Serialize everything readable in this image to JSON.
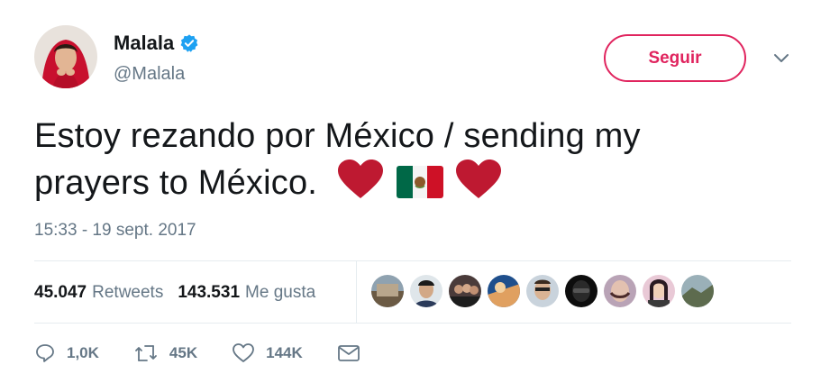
{
  "user": {
    "name": "Malala",
    "handle": "@Malala"
  },
  "follow_button": {
    "label": "Seguir"
  },
  "tweet": {
    "line1": "Estoy rezando por México / sending my",
    "line2": "prayers to México.",
    "emojis": [
      "red-heart",
      "mexico-flag",
      "red-heart"
    ]
  },
  "timestamp": "15:33 - 19 sept. 2017",
  "stats": {
    "retweets_count": "45.047",
    "retweets_label": "Retweets",
    "likes_count": "143.531",
    "likes_label": "Me gusta"
  },
  "actions": {
    "reply_count": "1,0K",
    "retweet_count": "45K",
    "like_count": "144K"
  },
  "colors": {
    "accent": "#e0245e",
    "verified": "#1da1f2",
    "muted": "#657786",
    "divider": "#e6ecf0"
  }
}
